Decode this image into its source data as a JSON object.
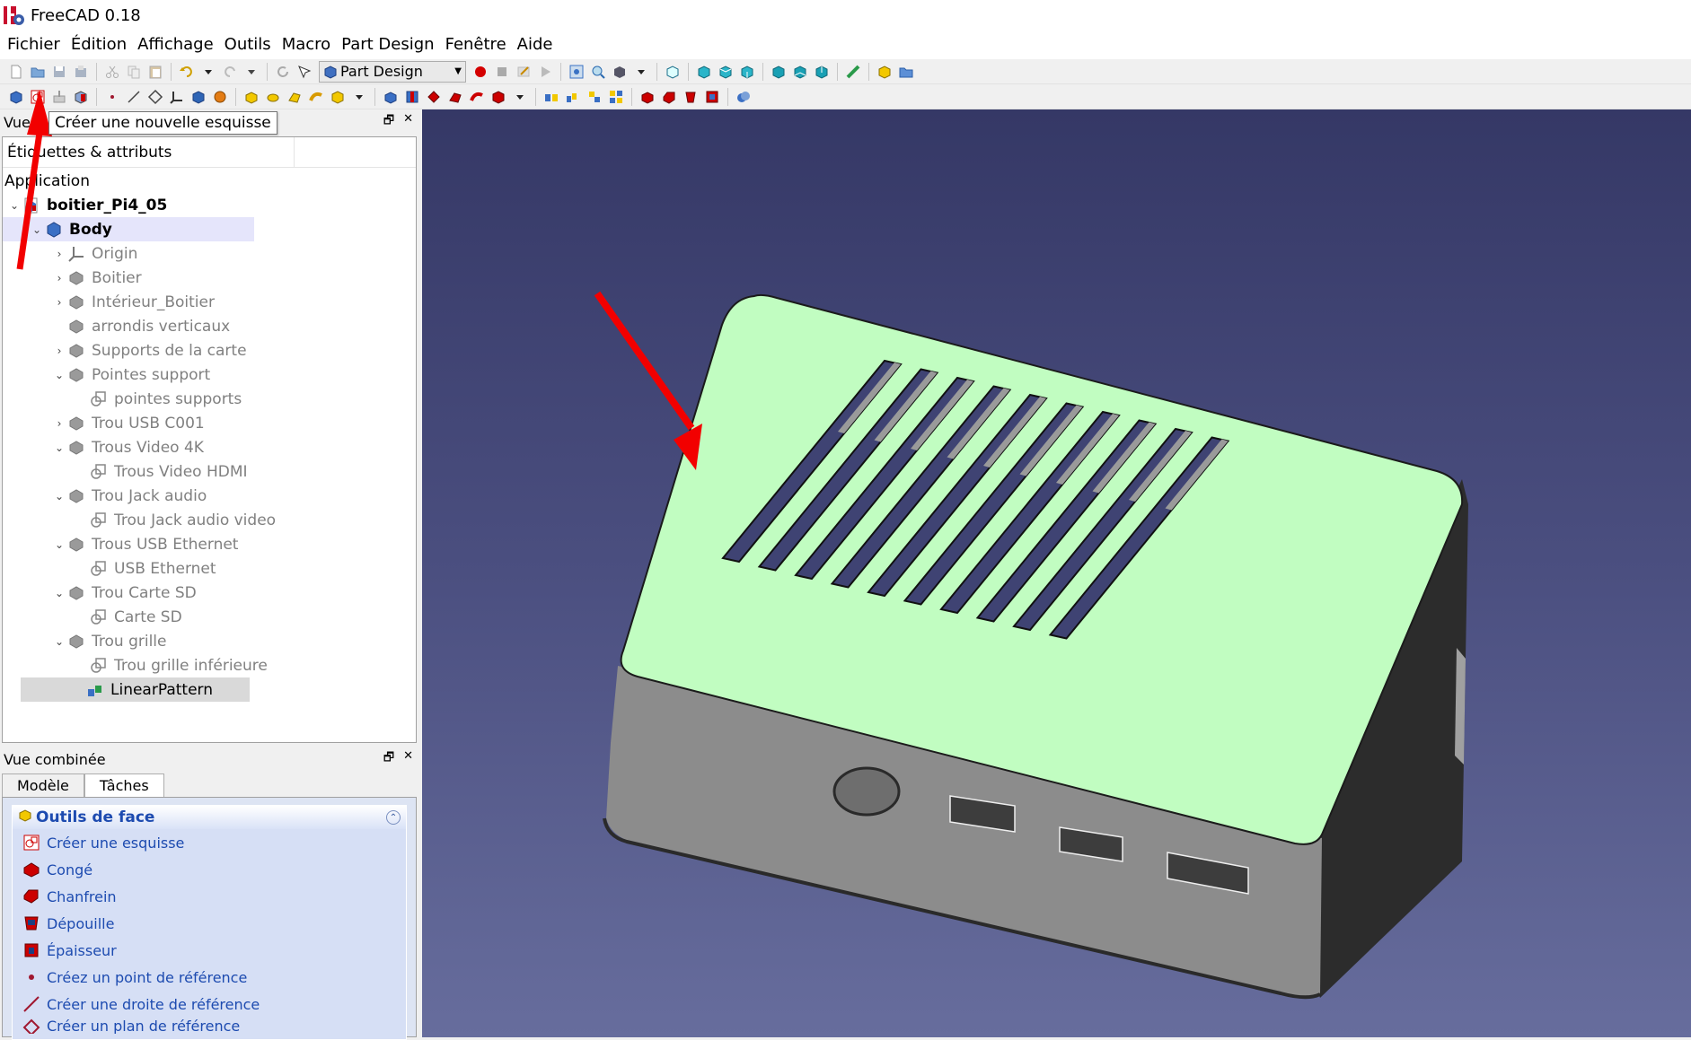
{
  "window": {
    "title": "FreeCAD 0.18"
  },
  "menubar": [
    "Fichier",
    "Édition",
    "Affichage",
    "Outils",
    "Macro",
    "Part Design",
    "Fenêtre",
    "Aide"
  ],
  "toolbar": {
    "workbench": "Part Design"
  },
  "tooltip": "Créer une nouvelle esquisse",
  "tree_panel": {
    "title": "Vue",
    "column_header": "Étiquettes & attributs",
    "application": "Application",
    "document": "boitier_Pi4_05",
    "body": "Body",
    "items": [
      {
        "label": "Origin"
      },
      {
        "label": "Boitier"
      },
      {
        "label": "Intérieur_Boitier"
      },
      {
        "label": "arrondis verticaux"
      },
      {
        "label": "Supports de la carte"
      },
      {
        "label": "Pointes support"
      },
      {
        "label": "pointes supports"
      },
      {
        "label": "Trou USB C001"
      },
      {
        "label": "Trous Video 4K"
      },
      {
        "label": "Trous Video HDMI"
      },
      {
        "label": "Trou Jack audio"
      },
      {
        "label": "Trou Jack audio video"
      },
      {
        "label": "Trous USB Ethernet"
      },
      {
        "label": "USB Ethernet"
      },
      {
        "label": "Trou Carte SD"
      },
      {
        "label": "Carte SD"
      },
      {
        "label": "Trou grille"
      },
      {
        "label": "Trou grille inférieure"
      },
      {
        "label": "LinearPattern"
      }
    ]
  },
  "combo_panel": {
    "title": "Vue combinée",
    "tabs": [
      "Modèle",
      "Tâches"
    ],
    "active_tab": "Tâches",
    "section_title": "Outils de face",
    "items": [
      "Créer une esquisse",
      "Congé",
      "Chanfrein",
      "Dépouille",
      "Épaisseur",
      "Créez un point de référence",
      "Créer une droite de référence",
      "Créer un plan de référence"
    ]
  },
  "colors": {
    "view_top": "#353866",
    "view_bottom": "#676d9d",
    "top_face": "#c1fdc1",
    "side_face": "#8c8c8c",
    "arrow": "#f20000",
    "task_link": "#1d4bb0"
  }
}
